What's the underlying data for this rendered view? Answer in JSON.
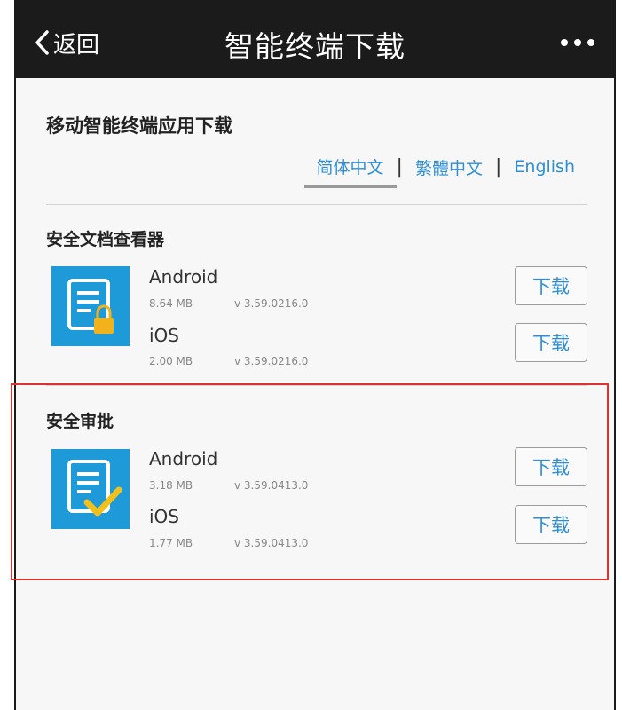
{
  "header": {
    "back_label": "返回",
    "title": "智能终端下载"
  },
  "page": {
    "heading": "移动智能终端应用下载"
  },
  "languages": [
    "简体中文",
    "繁體中文",
    "English"
  ],
  "apps": [
    {
      "name": "安全文档查看器",
      "builds": [
        {
          "platform": "Android",
          "size": "8.64 MB",
          "version": "v 3.59.0216.0",
          "button": "下载"
        },
        {
          "platform": "iOS",
          "size": "2.00 MB",
          "version": "v 3.59.0216.0",
          "button": "下载"
        }
      ]
    },
    {
      "name": "安全审批",
      "builds": [
        {
          "platform": "Android",
          "size": "3.18 MB",
          "version": "v 3.59.0413.0",
          "button": "下载"
        },
        {
          "platform": "iOS",
          "size": "1.77 MB",
          "version": "v 3.59.0413.0",
          "button": "下载"
        }
      ]
    }
  ],
  "colors": {
    "accent": "#2f8fd6",
    "topbar": "#1b1b1b",
    "highlight": "#e03030",
    "icon_bg": "#1f9ad9"
  }
}
